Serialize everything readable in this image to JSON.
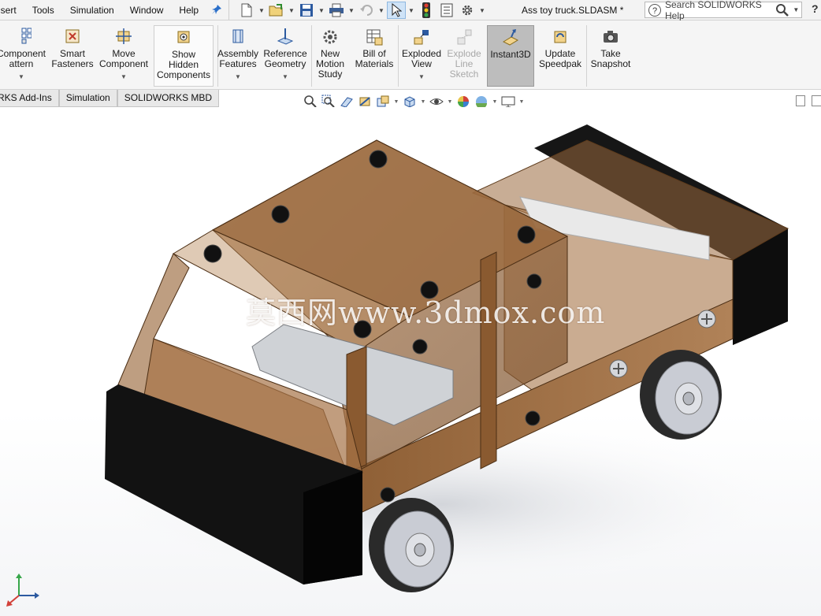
{
  "menubar": {
    "items": [
      "nsert",
      "Tools",
      "Simulation",
      "Window",
      "Help"
    ]
  },
  "document": {
    "title": "Ass toy truck.SLDASM *"
  },
  "search": {
    "placeholder": "Search SOLIDWORKS Help"
  },
  "help_label": "?",
  "ribbon": {
    "buttons": [
      {
        "label": "Component\nattern",
        "dropdown": true
      },
      {
        "label": "Smart\nFasteners",
        "dropdown": false
      },
      {
        "label": "Move\nComponent",
        "dropdown": true
      },
      {
        "label": "Show\nHidden\nComponents",
        "dropdown": false
      },
      {
        "label": "Assembly\nFeatures",
        "dropdown": true
      },
      {
        "label": "Reference\nGeometry",
        "dropdown": true
      },
      {
        "label": "New\nMotion\nStudy",
        "dropdown": false
      },
      {
        "label": "Bill of\nMaterials",
        "dropdown": false
      },
      {
        "label": "Exploded\nView",
        "dropdown": true
      },
      {
        "label": "Explode\nLine\nSketch",
        "dropdown": false,
        "disabled": true
      },
      {
        "label": "Instant3D",
        "dropdown": false,
        "active": true
      },
      {
        "label": "Update\nSpeedpak",
        "dropdown": false
      },
      {
        "label": "Take\nSnapshot",
        "dropdown": false
      }
    ]
  },
  "tabs": [
    "RKS Add-Ins",
    "Simulation",
    "SOLIDWORKS MBD"
  ],
  "watermark": "莫西网www.3dmox.com",
  "colors": {
    "wood": "#9b6a3e",
    "wood_glass": "#8a5a30",
    "bumper": "#121212",
    "tire": "#2a2a2a",
    "hub": "#c9ccd4",
    "accent": "#2a6fc9"
  }
}
